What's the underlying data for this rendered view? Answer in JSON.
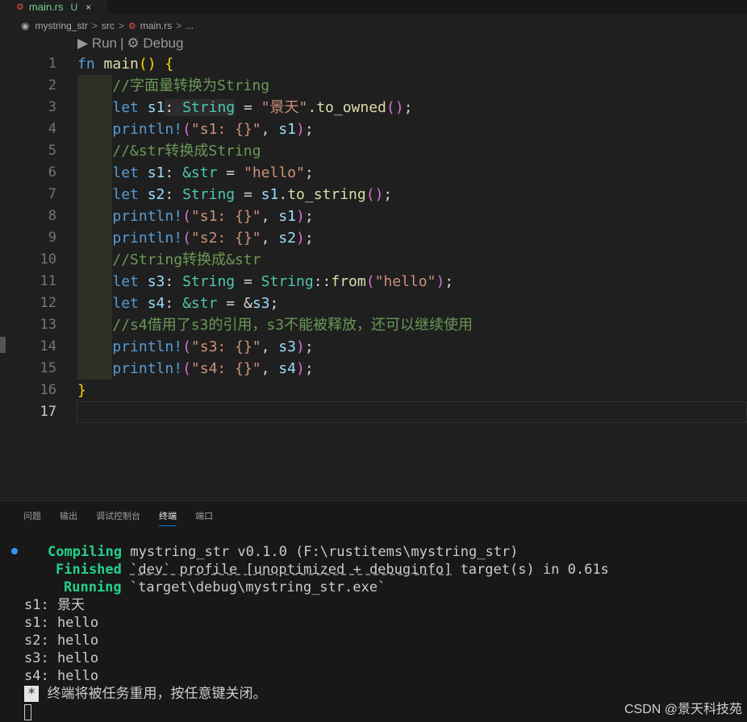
{
  "tab": {
    "filename": "main.rs",
    "modified": "U",
    "close": "×",
    "rust_icon": "⚙"
  },
  "breadcrumb": {
    "project": "mystring_str",
    "folder": "src",
    "file": "main.rs",
    "more": "...",
    "sep": ">"
  },
  "codelens": {
    "run": "▶ Run",
    "sep": "|",
    "debug": "⚙ Debug"
  },
  "line_numbers": [
    "1",
    "2",
    "3",
    "4",
    "5",
    "6",
    "7",
    "8",
    "9",
    "10",
    "11",
    "12",
    "13",
    "14",
    "15",
    "16",
    "17"
  ],
  "code": {
    "l1": {
      "kw": "fn",
      "name": "main",
      "open": "(",
      "close": ")",
      "brace": "{"
    },
    "l2": "//字面量转换为String",
    "l3": {
      "let": "let",
      "var": "s1",
      "colon": ":",
      "type": "String",
      "eq": "=",
      "str": "\"景天\"",
      "dot": ".",
      "method": "to_owned",
      "paren": "()",
      "semi": ";"
    },
    "l4": {
      "mac": "println!",
      "open": "(",
      "str": "\"s1: {}\"",
      "comma": ",",
      "var": "s1",
      "close": ")",
      "semi": ";"
    },
    "l5": "//&str转换成String",
    "l6": {
      "let": "let",
      "var": "s1",
      "colon": ":",
      "type": "&str",
      "eq": "=",
      "str": "\"hello\"",
      "semi": ";"
    },
    "l7": {
      "let": "let",
      "var": "s2",
      "colon": ":",
      "type": "String",
      "eq": "=",
      "var2": "s1",
      "dot": ".",
      "method": "to_string",
      "paren": "()",
      "semi": ";"
    },
    "l8": {
      "mac": "println!",
      "open": "(",
      "str": "\"s1: {}\"",
      "comma": ",",
      "var": "s1",
      "close": ")",
      "semi": ";"
    },
    "l9": {
      "mac": "println!",
      "open": "(",
      "str": "\"s2: {}\"",
      "comma": ",",
      "var": "s2",
      "close": ")",
      "semi": ";"
    },
    "l10": "//String转换成&str",
    "l11": {
      "let": "let",
      "var": "s3",
      "colon": ":",
      "type": "String",
      "eq": "=",
      "type2": "String",
      "path": "::",
      "method": "from",
      "open": "(",
      "str": "\"hello\"",
      "close": ")",
      "semi": ";"
    },
    "l12": {
      "let": "let",
      "var": "s4",
      "colon": ":",
      "type": "&str",
      "eq": "=",
      "amp": "&",
      "var2": "s3",
      "semi": ";"
    },
    "l13": "//s4借用了s3的引用，s3不能被释放，还可以继续使用",
    "l14": {
      "mac": "println!",
      "open": "(",
      "str": "\"s3: {}\"",
      "comma": ",",
      "var": "s3",
      "close": ")",
      "semi": ";"
    },
    "l15": {
      "mac": "println!",
      "open": "(",
      "str": "\"s4: {}\"",
      "comma": ",",
      "var": "s4",
      "close": ")",
      "semi": ";"
    },
    "l16": "}"
  },
  "panel_tabs": [
    "问题",
    "输出",
    "调试控制台",
    "终端",
    "端口"
  ],
  "terminal": {
    "compiling_label": "Compiling",
    "compiling_text": "mystring_str v0.1.0 (F:\\rustitems\\mystring_str)",
    "finished_label": "Finished",
    "finished_profile": "`dev` profile [unoptimized + debuginfo]",
    "finished_text": "target(s) in 0.61s",
    "running_label": "Running",
    "running_text": "`target\\debug\\mystring_str.exe`",
    "out1": "s1: 景天",
    "out2": "s1: hello",
    "out3": "s2: hello",
    "out4": "s3: hello",
    "out5": "s4: hello",
    "star": "*",
    "reuse_msg": "终端将被任务重用，按任意键关闭。"
  },
  "watermark": "CSDN @景天科技苑"
}
